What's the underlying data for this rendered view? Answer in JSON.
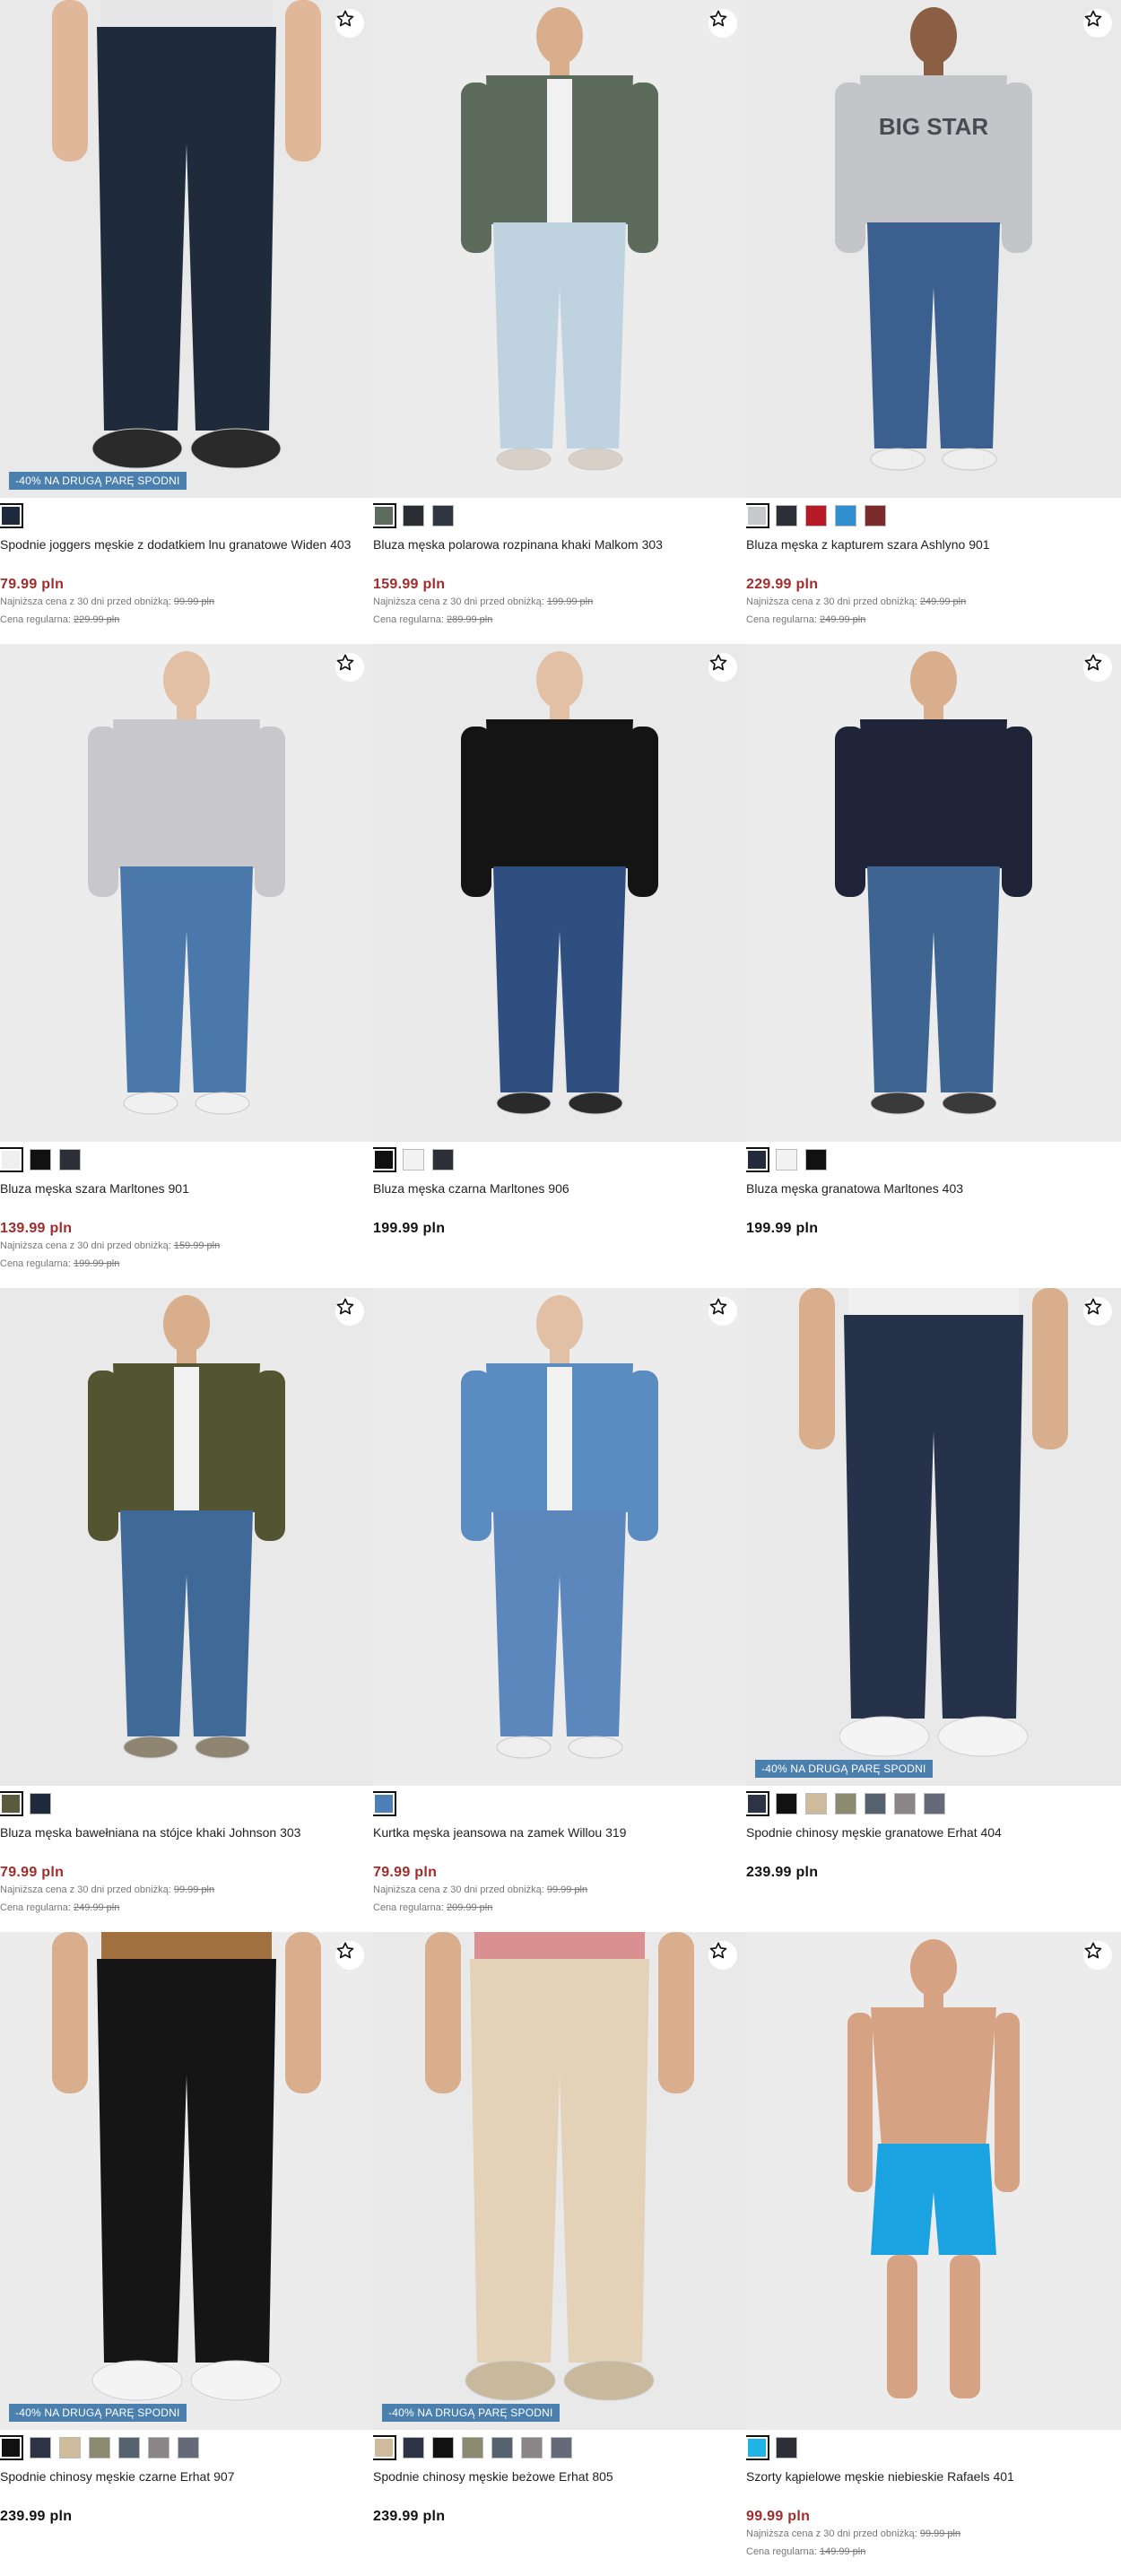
{
  "promo_label": "-40% NA DRUGĄ PARĘ SPODNI",
  "lowest_prefix": "Najniższa cena z 30 dni przed obniżką:",
  "regular_prefix": "Cena regularna:",
  "products": [
    {
      "name": "Spodnie joggers męskie z dodatkiem lnu granatowe Widen 403",
      "price": "79.99 pln",
      "sale": true,
      "lowest": "99.99 pln",
      "regular": "229.99 pln",
      "promo": true,
      "swatches": [
        "#1f2a3d"
      ],
      "icon": "star-icon"
    },
    {
      "name": "Bluza męska polarowa rozpinana khaki Malkom 303",
      "price": "159.99 pln",
      "sale": true,
      "lowest": "199.99 pln",
      "regular": "289.99 pln",
      "promo": false,
      "swatches": [
        "#5e6b5f",
        "#2b2d33",
        "#303542"
      ],
      "icon": "star-icon"
    },
    {
      "name": "Bluza męska z kapturem szara Ashlyno 901",
      "price": "229.99 pln",
      "sale": true,
      "lowest": "249.99 pln",
      "regular": "249.99 pln",
      "promo": false,
      "swatches": [
        "#c7c8cc",
        "#2c2f38",
        "#b71b25",
        "#2f8fcf",
        "#7c2b2b"
      ],
      "icon": "star-icon"
    },
    {
      "name": "Bluza męska szara Marltones 901",
      "price": "139.99 pln",
      "sale": true,
      "lowest": "159.99 pln",
      "regular": "199.99 pln",
      "promo": false,
      "swatches": [
        "#efefef",
        "#111111",
        "#2c2f38"
      ],
      "icon": "star-icon"
    },
    {
      "name": "Bluza męska czarna Marltones 906",
      "price": "199.99 pln",
      "sale": false,
      "promo": false,
      "swatches": [
        "#111111",
        "#f2f2f2",
        "#2c2f38"
      ],
      "icon": "star-icon"
    },
    {
      "name": "Bluza męska granatowa Marltones 403",
      "price": "199.99 pln",
      "sale": false,
      "promo": false,
      "swatches": [
        "#232a3a",
        "#f2f2f2",
        "#111111"
      ],
      "icon": "star-icon"
    },
    {
      "name": "Bluza męska bawełniana na stójce khaki Johnson 303",
      "price": "79.99 pln",
      "sale": true,
      "lowest": "99.99 pln",
      "regular": "249.99 pln",
      "promo": false,
      "swatches": [
        "#5a5a3c",
        "#1f2a3d"
      ],
      "icon": "star-icon"
    },
    {
      "name": "Kurtka męska jeansowa na zamek Willou 319",
      "price": "79.99 pln",
      "sale": true,
      "lowest": "99.99 pln",
      "regular": "209.99 pln",
      "promo": false,
      "swatches": [
        "#4f7fb7"
      ],
      "icon": "star-icon"
    },
    {
      "name": "Spodnie chinosy męskie granatowe Erhat 404",
      "price": "239.99 pln",
      "sale": false,
      "promo": true,
      "swatches": [
        "#2c3344",
        "#111111",
        "#cdbb9c",
        "#8c8a70",
        "#56616f",
        "#8a8587",
        "#646a78"
      ],
      "icon": "star-icon"
    },
    {
      "name": "Spodnie chinosy męskie czarne Erhat 907",
      "price": "239.99 pln",
      "sale": false,
      "promo": true,
      "swatches": [
        "#111111",
        "#2c3344",
        "#cdbb9c",
        "#8c8a70",
        "#56616f",
        "#8a8587",
        "#646a78"
      ],
      "icon": "star-icon"
    },
    {
      "name": "Spodnie chinosy męskie beżowe Erhat 805",
      "price": "239.99 pln",
      "sale": false,
      "promo": true,
      "swatches": [
        "#cdbb9c",
        "#2c3344",
        "#111111",
        "#8c8a70",
        "#56616f",
        "#8a8587",
        "#646a78"
      ],
      "icon": "star-icon"
    },
    {
      "name": "Szorty kąpielowe męskie niebieskie Rafaels 401",
      "price": "99.99 pln",
      "sale": true,
      "lowest": "99.99 pln",
      "regular": "149.99 pln",
      "promo": false,
      "swatches": [
        "#1fb3e6",
        "#2c2f38"
      ],
      "icon": "star-icon"
    }
  ],
  "figures": [
    {
      "kind": "pants",
      "top": "#e6e6e6",
      "bottom": "#1f2b3b",
      "shoe": "#2a2a2a",
      "skin": "#e0b799",
      "head": false
    },
    {
      "kind": "fleece",
      "top": "#5c6b5c",
      "bottom": "#bfd2df",
      "shoe": "#d8d0c6",
      "skin": "#d9ae8d",
      "head": true
    },
    {
      "kind": "hoodie",
      "top": "#c4c5c8",
      "bottom": "#3b5f8e",
      "shoe": "#eeeeee",
      "skin": "#8a5f43",
      "head": true
    },
    {
      "kind": "sweat",
      "top": "#c8c8cc",
      "bottom": "#4b78ab",
      "shoe": "#f0f0f0",
      "skin": "#e2c0a6",
      "head": true
    },
    {
      "kind": "sweat",
      "top": "#141414",
      "bottom": "#2e4f80",
      "shoe": "#2a2a2a",
      "skin": "#e2c0a6",
      "head": true
    },
    {
      "kind": "sweat",
      "top": "#1f2438",
      "bottom": "#3e6592",
      "shoe": "#3a3a3a",
      "skin": "#d9ae8d",
      "head": true
    },
    {
      "kind": "jacket",
      "top": "#52552f",
      "bottom": "#3f6a98",
      "shoe": "#8d8570",
      "skin": "#d9ae8d",
      "head": true
    },
    {
      "kind": "denim",
      "top": "#5a8cc2",
      "bottom": "#5b87bd",
      "shoe": "#eeeeee",
      "skin": "#e2c0a6",
      "head": true
    },
    {
      "kind": "pants",
      "top": "#f0f0f0",
      "bottom": "#26314a",
      "shoe": "#f4f4f4",
      "skin": "#d9ae8d",
      "head": false
    },
    {
      "kind": "pants",
      "top": "#a0713e",
      "bottom": "#151515",
      "shoe": "#f4f4f4",
      "skin": "#d9ae8d",
      "head": false
    },
    {
      "kind": "pants",
      "top": "#d99090",
      "bottom": "#e3d2b8",
      "shoe": "#c9b99c",
      "skin": "#d9ae8d",
      "head": false
    },
    {
      "kind": "shorts",
      "top": "#d6a284",
      "bottom": "#1aa3e0",
      "shoe": "#d6a284",
      "skin": "#d6a284",
      "head": true
    }
  ]
}
